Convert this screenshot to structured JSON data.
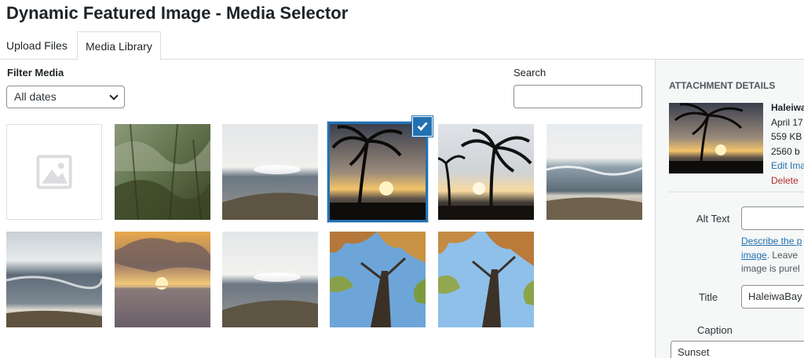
{
  "modal": {
    "title": "Dynamic Featured Image - Media Selector"
  },
  "tabs": [
    {
      "label": "Upload Files",
      "active": false
    },
    {
      "label": "Media Library",
      "active": true
    }
  ],
  "toolbar": {
    "filter_label": "Filter Media",
    "filter_value": "All dates",
    "search_label": "Search",
    "search_value": ""
  },
  "grid": {
    "items": [
      {
        "type": "placeholder",
        "icon": "image-placeholder-icon",
        "selected": false
      },
      {
        "type": "photo",
        "subject": "forest-foliage",
        "selected": false
      },
      {
        "type": "photo",
        "subject": "beach-overcast",
        "selected": false
      },
      {
        "type": "photo",
        "subject": "palm-sunset",
        "selected": true
      },
      {
        "type": "photo",
        "subject": "palm-sunset-2",
        "selected": false
      },
      {
        "type": "photo",
        "subject": "beach-waves",
        "selected": false
      },
      {
        "type": "photo",
        "subject": "beach-waves-2",
        "selected": false
      },
      {
        "type": "photo",
        "subject": "ocean-sunset-clouds",
        "selected": false
      },
      {
        "type": "photo",
        "subject": "beach-overcast-2",
        "selected": false
      },
      {
        "type": "photo",
        "subject": "tree-canopy",
        "selected": false
      },
      {
        "type": "photo",
        "subject": "tree-canopy-2",
        "selected": false
      }
    ],
    "selected_icon": "checkmark-icon"
  },
  "sidebar": {
    "heading": "ATTACHMENT DETAILS",
    "filename": "Haleiwa",
    "date": "April 17",
    "filesize": "559 KB",
    "dimensions": "2560 b",
    "edit_link": "Edit Ima",
    "delete_link": "Delete",
    "alt_text_label": "Alt Text",
    "alt_text_value": "",
    "help_link_1": "Describe the p",
    "help_link_2": "image",
    "help_text_1": ". Leave",
    "help_text_2": "image is purel",
    "title_label": "Title",
    "title_value": "HaleiwaBay",
    "caption_label": "Caption",
    "caption_value": "Sunset"
  },
  "colors": {
    "accent": "#2271b1",
    "danger": "#b32d2e",
    "sidebar_bg": "#f6f7f7",
    "border": "#dcdcde"
  }
}
